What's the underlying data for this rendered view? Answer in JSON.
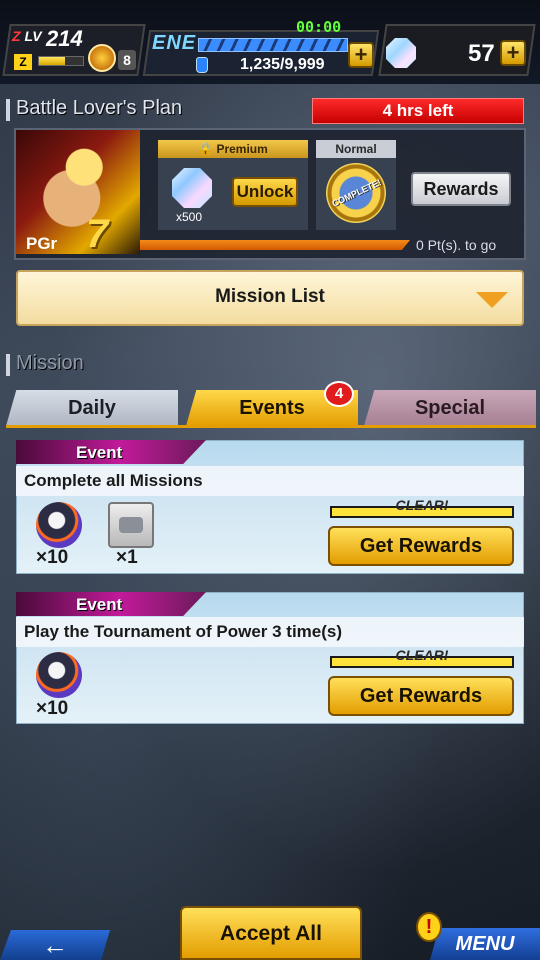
{
  "hud": {
    "rank_prefix": "Z",
    "rank_label": "LV",
    "level": "214",
    "xp_progress": 0.6,
    "medal_count": "8",
    "energy_label": "ENE",
    "energy_timer": "00:00",
    "energy_count": "1,235/9,999",
    "energy_plus": "+",
    "stone_count": "57",
    "stone_plus": "+"
  },
  "plan": {
    "title": "Battle Lover's Plan",
    "time_left": "4 hrs left",
    "pgr_label": "PGr",
    "pgr_value": "7",
    "premium_label": "Premium",
    "premium_reward_qty": "x500",
    "unlock_label": "Unlock",
    "normal_label": "Normal",
    "complete_badge": "COMPLETE!",
    "rewards_label": "Rewards",
    "points_text": "0 Pt(s). to go"
  },
  "mission_list": {
    "label": "Mission List"
  },
  "missions": {
    "section_title": "Mission",
    "tabs": [
      {
        "label": "Daily"
      },
      {
        "label": "Events",
        "badge": "4"
      },
      {
        "label": "Special"
      }
    ],
    "items": [
      {
        "tag": "Event",
        "description": "Complete all Missions",
        "rewards": [
          {
            "icon": "dragonball-fragment-icon",
            "qty": "×10"
          },
          {
            "icon": "ticket-icon",
            "qty": "×1"
          }
        ],
        "status": "CLEAR!",
        "button_label": "Get Rewards"
      },
      {
        "tag": "Event",
        "description": "Play the Tournament of Power 3 time(s)",
        "rewards": [
          {
            "icon": "dragonball-fragment-icon",
            "qty": "×10"
          }
        ],
        "status": "CLEAR!",
        "button_label": "Get Rewards"
      }
    ]
  },
  "footer": {
    "accept_all_label": "Accept All",
    "back_label": "←",
    "menu_label": "MENU",
    "alert_label": "!"
  },
  "colors": {
    "accent_gold": "#e39d00",
    "alert_red": "#e01c1c",
    "energy_green": "#62ff3a"
  }
}
